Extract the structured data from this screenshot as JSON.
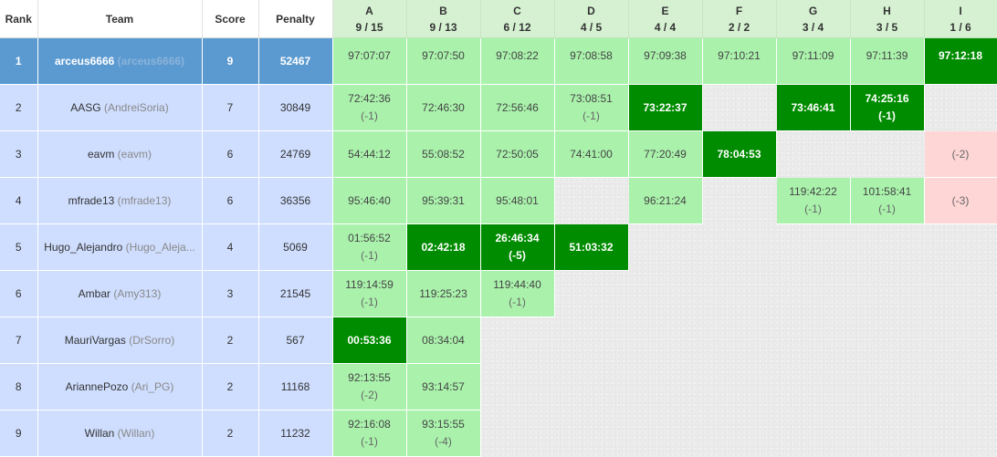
{
  "headers": {
    "rank": "Rank",
    "team": "Team",
    "score": "Score",
    "penalty": "Penalty"
  },
  "problems": [
    {
      "letter": "A",
      "ratio": "9 / 15"
    },
    {
      "letter": "B",
      "ratio": "9 / 13"
    },
    {
      "letter": "C",
      "ratio": "6 / 12"
    },
    {
      "letter": "D",
      "ratio": "4 / 5"
    },
    {
      "letter": "E",
      "ratio": "4 / 4"
    },
    {
      "letter": "F",
      "ratio": "2 / 2"
    },
    {
      "letter": "G",
      "ratio": "3 / 4"
    },
    {
      "letter": "H",
      "ratio": "3 / 5"
    },
    {
      "letter": "I",
      "ratio": "1 / 6"
    }
  ],
  "colors": {
    "first_solve": "#008c00",
    "solved": "#aaf2ac",
    "failed": "#ffd6d6",
    "row_bg": "#cfdeff",
    "top_row_bg": "#5b9ad1",
    "header_problem_bg": "#d6f1d2"
  },
  "rows": [
    {
      "rank": "1",
      "name": "arceus6666",
      "handle": "(arceus6666)",
      "score": "9",
      "penalty": "52467",
      "cells": [
        {
          "status": "solved",
          "time": "97:07:07",
          "tries": ""
        },
        {
          "status": "solved",
          "time": "97:07:50",
          "tries": ""
        },
        {
          "status": "solved",
          "time": "97:08:22",
          "tries": ""
        },
        {
          "status": "solved",
          "time": "97:08:58",
          "tries": ""
        },
        {
          "status": "solved",
          "time": "97:09:38",
          "tries": ""
        },
        {
          "status": "solved",
          "time": "97:10:21",
          "tries": ""
        },
        {
          "status": "solved",
          "time": "97:11:09",
          "tries": ""
        },
        {
          "status": "solved",
          "time": "97:11:39",
          "tries": ""
        },
        {
          "status": "first",
          "time": "97:12:18",
          "tries": ""
        }
      ]
    },
    {
      "rank": "2",
      "name": "AASG",
      "handle": "(AndreiSoria)",
      "score": "7",
      "penalty": "30849",
      "cells": [
        {
          "status": "solved",
          "time": "72:42:36",
          "tries": "(-1)"
        },
        {
          "status": "solved",
          "time": "72:46:30",
          "tries": ""
        },
        {
          "status": "solved",
          "time": "72:56:46",
          "tries": ""
        },
        {
          "status": "solved",
          "time": "73:08:51",
          "tries": "(-1)"
        },
        {
          "status": "first",
          "time": "73:22:37",
          "tries": ""
        },
        {
          "status": "empty",
          "time": "",
          "tries": ""
        },
        {
          "status": "first",
          "time": "73:46:41",
          "tries": ""
        },
        {
          "status": "first",
          "time": "74:25:16",
          "tries": "(-1)"
        },
        {
          "status": "empty",
          "time": "",
          "tries": ""
        }
      ]
    },
    {
      "rank": "3",
      "name": "eavm",
      "handle": "(eavm)",
      "score": "6",
      "penalty": "24769",
      "cells": [
        {
          "status": "solved",
          "time": "54:44:12",
          "tries": ""
        },
        {
          "status": "solved",
          "time": "55:08:52",
          "tries": ""
        },
        {
          "status": "solved",
          "time": "72:50:05",
          "tries": ""
        },
        {
          "status": "solved",
          "time": "74:41:00",
          "tries": ""
        },
        {
          "status": "solved",
          "time": "77:20:49",
          "tries": ""
        },
        {
          "status": "first",
          "time": "78:04:53",
          "tries": ""
        },
        {
          "status": "empty",
          "time": "",
          "tries": ""
        },
        {
          "status": "empty",
          "time": "",
          "tries": ""
        },
        {
          "status": "failed",
          "time": "",
          "tries": "(-2)"
        }
      ]
    },
    {
      "rank": "4",
      "name": "mfrade13",
      "handle": "(mfrade13)",
      "score": "6",
      "penalty": "36356",
      "cells": [
        {
          "status": "solved",
          "time": "95:46:40",
          "tries": ""
        },
        {
          "status": "solved",
          "time": "95:39:31",
          "tries": ""
        },
        {
          "status": "solved",
          "time": "95:48:01",
          "tries": ""
        },
        {
          "status": "empty",
          "time": "",
          "tries": ""
        },
        {
          "status": "solved",
          "time": "96:21:24",
          "tries": ""
        },
        {
          "status": "empty",
          "time": "",
          "tries": ""
        },
        {
          "status": "solved",
          "time": "119:42:22",
          "tries": "(-1)"
        },
        {
          "status": "solved",
          "time": "101:58:41",
          "tries": "(-1)"
        },
        {
          "status": "failed",
          "time": "",
          "tries": "(-3)"
        }
      ]
    },
    {
      "rank": "5",
      "name": "Hugo_Alejandro",
      "handle": "(Hugo_Aleja...",
      "score": "4",
      "penalty": "5069",
      "cells": [
        {
          "status": "solved",
          "time": "01:56:52",
          "tries": "(-1)"
        },
        {
          "status": "first",
          "time": "02:42:18",
          "tries": ""
        },
        {
          "status": "first",
          "time": "26:46:34",
          "tries": "(-5)"
        },
        {
          "status": "first",
          "time": "51:03:32",
          "tries": ""
        },
        {
          "status": "empty",
          "time": "",
          "tries": ""
        },
        {
          "status": "empty",
          "time": "",
          "tries": ""
        },
        {
          "status": "empty",
          "time": "",
          "tries": ""
        },
        {
          "status": "empty",
          "time": "",
          "tries": ""
        },
        {
          "status": "empty",
          "time": "",
          "tries": ""
        }
      ]
    },
    {
      "rank": "6",
      "name": "Ambar",
      "handle": "(Amy313)",
      "score": "3",
      "penalty": "21545",
      "cells": [
        {
          "status": "solved",
          "time": "119:14:59",
          "tries": "(-1)"
        },
        {
          "status": "solved",
          "time": "119:25:23",
          "tries": ""
        },
        {
          "status": "solved",
          "time": "119:44:40",
          "tries": "(-1)"
        },
        {
          "status": "empty",
          "time": "",
          "tries": ""
        },
        {
          "status": "empty",
          "time": "",
          "tries": ""
        },
        {
          "status": "empty",
          "time": "",
          "tries": ""
        },
        {
          "status": "empty",
          "time": "",
          "tries": ""
        },
        {
          "status": "empty",
          "time": "",
          "tries": ""
        },
        {
          "status": "empty",
          "time": "",
          "tries": ""
        }
      ]
    },
    {
      "rank": "7",
      "name": "MauriVargas",
      "handle": "(DrSorro)",
      "score": "2",
      "penalty": "567",
      "cells": [
        {
          "status": "first",
          "time": "00:53:36",
          "tries": ""
        },
        {
          "status": "solved",
          "time": "08:34:04",
          "tries": ""
        },
        {
          "status": "empty",
          "time": "",
          "tries": ""
        },
        {
          "status": "empty",
          "time": "",
          "tries": ""
        },
        {
          "status": "empty",
          "time": "",
          "tries": ""
        },
        {
          "status": "empty",
          "time": "",
          "tries": ""
        },
        {
          "status": "empty",
          "time": "",
          "tries": ""
        },
        {
          "status": "empty",
          "time": "",
          "tries": ""
        },
        {
          "status": "empty",
          "time": "",
          "tries": ""
        }
      ]
    },
    {
      "rank": "8",
      "name": "AriannePozo",
      "handle": "(Ari_PG)",
      "score": "2",
      "penalty": "11168",
      "cells": [
        {
          "status": "solved",
          "time": "92:13:55",
          "tries": "(-2)"
        },
        {
          "status": "solved",
          "time": "93:14:57",
          "tries": ""
        },
        {
          "status": "empty",
          "time": "",
          "tries": ""
        },
        {
          "status": "empty",
          "time": "",
          "tries": ""
        },
        {
          "status": "empty",
          "time": "",
          "tries": ""
        },
        {
          "status": "empty",
          "time": "",
          "tries": ""
        },
        {
          "status": "empty",
          "time": "",
          "tries": ""
        },
        {
          "status": "empty",
          "time": "",
          "tries": ""
        },
        {
          "status": "empty",
          "time": "",
          "tries": ""
        }
      ]
    },
    {
      "rank": "9",
      "name": "Willan",
      "handle": "(Willan)",
      "score": "2",
      "penalty": "11232",
      "cells": [
        {
          "status": "solved",
          "time": "92:16:08",
          "tries": "(-1)"
        },
        {
          "status": "solved",
          "time": "93:15:55",
          "tries": "(-4)"
        },
        {
          "status": "empty",
          "time": "",
          "tries": ""
        },
        {
          "status": "empty",
          "time": "",
          "tries": ""
        },
        {
          "status": "empty",
          "time": "",
          "tries": ""
        },
        {
          "status": "empty",
          "time": "",
          "tries": ""
        },
        {
          "status": "empty",
          "time": "",
          "tries": ""
        },
        {
          "status": "empty",
          "time": "",
          "tries": ""
        },
        {
          "status": "empty",
          "time": "",
          "tries": ""
        }
      ]
    }
  ]
}
